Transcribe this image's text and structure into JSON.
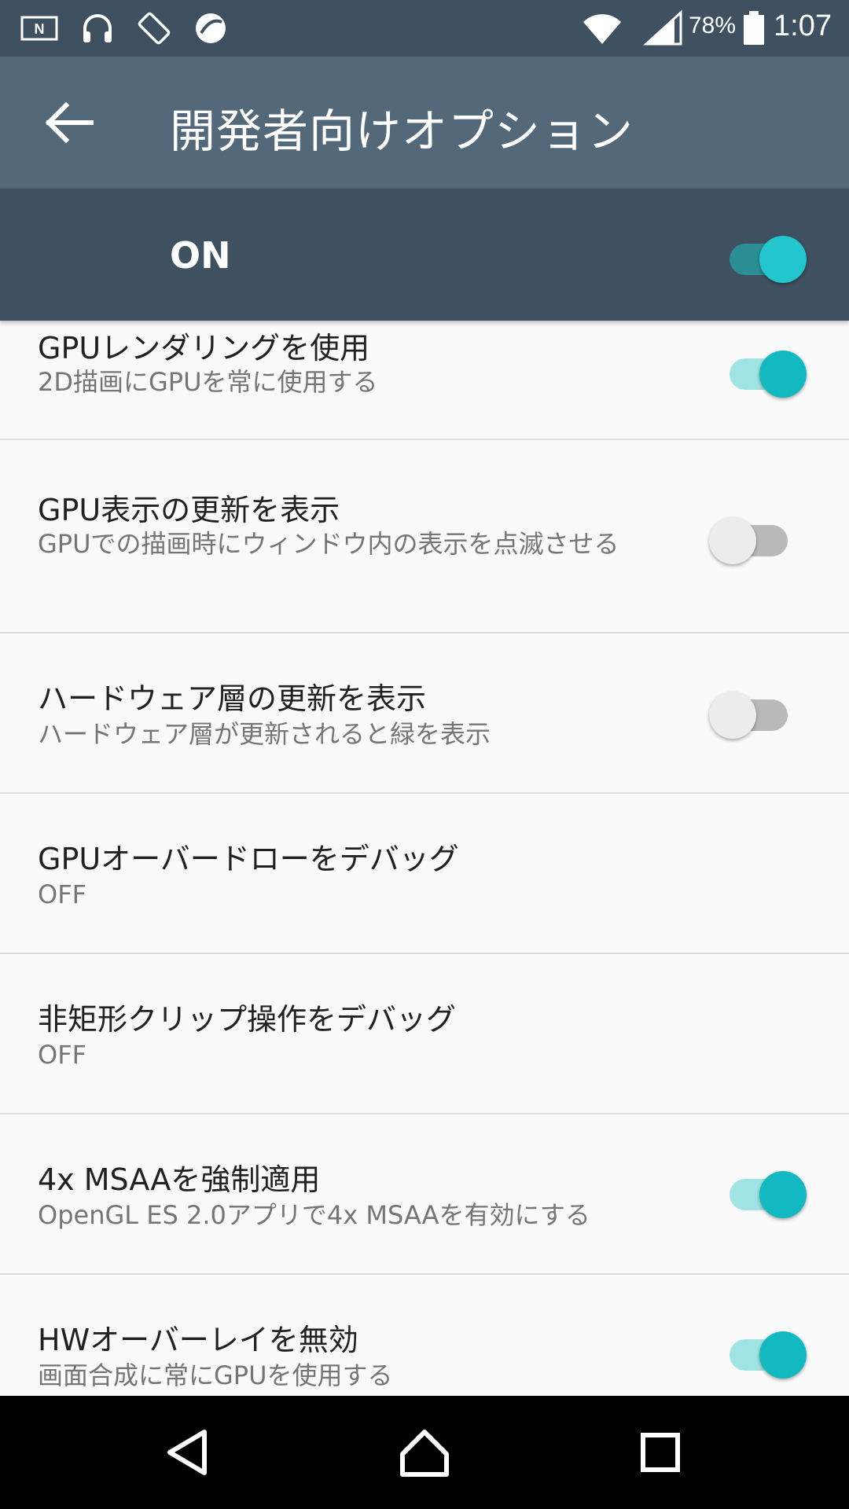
{
  "status_bar": {
    "icons": [
      "nfc-icon",
      "headphones-icon",
      "screen-rotation-icon",
      "app-notification-icon",
      "wifi-icon",
      "cell-signal-icon",
      "battery-icon"
    ],
    "battery_percent": "78%",
    "time": "1:07"
  },
  "app_bar": {
    "title": "開発者向けオプション",
    "back_icon": "arrow-back-icon"
  },
  "master_switch": {
    "label": "ON",
    "state": "on"
  },
  "settings": [
    {
      "title": "GPUレンダリングを使用",
      "subtitle": "2D描画にGPUを常に使用する",
      "switch": "on"
    },
    {
      "title": "GPU表示の更新を表示",
      "subtitle": "GPUでの描画時にウィンドウ内の表示を点滅させる",
      "switch": "off"
    },
    {
      "title": "ハードウェア層の更新を表示",
      "subtitle": "ハードウェア層が更新されると緑を表示",
      "switch": "off"
    },
    {
      "title": "GPUオーバードローをデバッグ",
      "subtitle": "OFF"
    },
    {
      "title": "非矩形クリップ操作をデバッグ",
      "subtitle": "OFF"
    },
    {
      "title": "4x MSAAを強制適用",
      "subtitle": "OpenGL ES 2.0アプリで4x MSAAを有効にする",
      "switch": "on"
    },
    {
      "title": "HWオーバーレイを無効",
      "subtitle": "画面合成に常にGPUを使用する",
      "switch": "on"
    }
  ],
  "nav_bar": {
    "buttons": [
      "back-triangle-icon",
      "home-icon",
      "recents-icon"
    ]
  },
  "colors": {
    "status_bar": "#3f5060",
    "app_bar": "#536878",
    "accent": "#12b9c0"
  }
}
